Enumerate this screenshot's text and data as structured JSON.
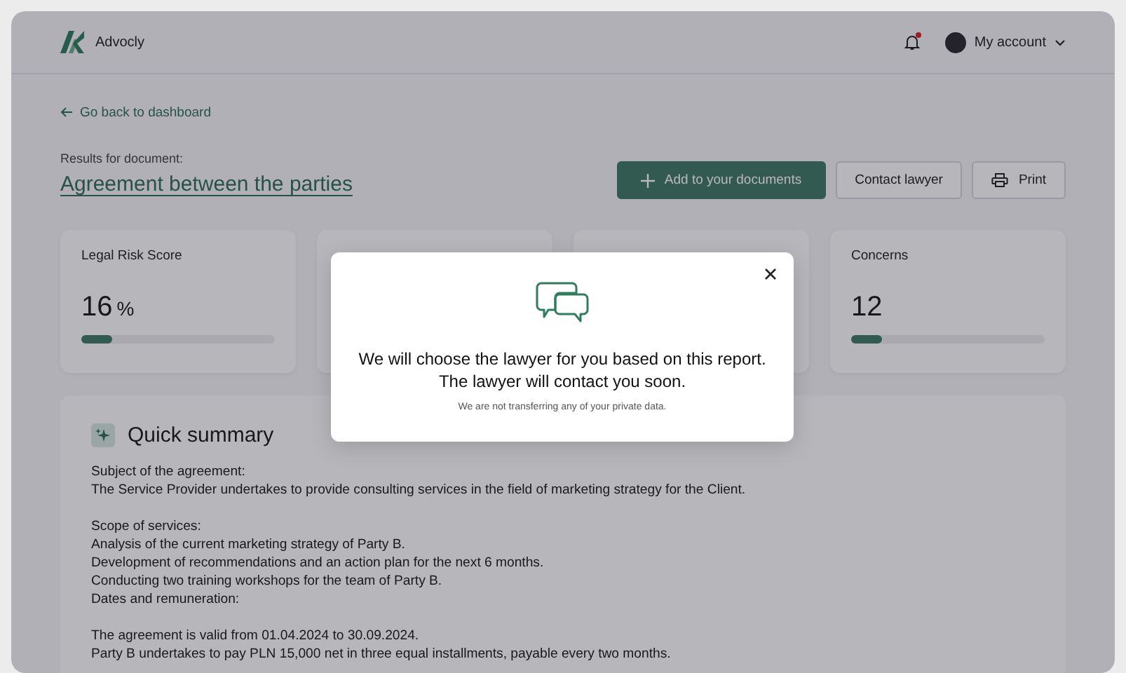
{
  "header": {
    "brand": "Advocly",
    "has_notification": true,
    "account_label": "My account"
  },
  "back_link": "Go back to dashboard",
  "document": {
    "caption": "Results for document:",
    "title": "Agreement between the parties"
  },
  "actions": [
    {
      "kind": "add",
      "label": "Add to your documents"
    },
    {
      "kind": "plain",
      "label": "Contact lawyer"
    },
    {
      "kind": "print",
      "label": "Print"
    }
  ],
  "score_cards": [
    {
      "kind": "score",
      "title": "Legal Risk Score",
      "value": "16",
      "unit": "%",
      "level": 0.16
    },
    {
      "kind": "covered"
    },
    {
      "kind": "covered"
    },
    {
      "kind": "score",
      "title": "Concerns",
      "value": "12",
      "level": 0.16
    }
  ],
  "summary": {
    "title": "Quick summary",
    "paragraphs": [
      [
        "Subject of the agreement:",
        "The Service Provider undertakes to provide consulting services in the field of marketing strategy for the Client."
      ],
      [
        "Scope of services:",
        "Analysis of the current marketing strategy of Party B.",
        "Development of recommendations and an action plan for the next 6 months.",
        "Conducting two training workshops for the team of Party B.",
        "Dates and remuneration:"
      ],
      [
        "The agreement is valid from 01.04.2024 to 30.09.2024.",
        "Party B undertakes to pay PLN 15,000 net in three equal installments, payable every two months."
      ]
    ]
  },
  "modal": {
    "message_lines": [
      "We will choose the lawyer for you based on this report.",
      "The lawyer will contact you soon."
    ],
    "note": "We are not transferring any of your private data."
  }
}
